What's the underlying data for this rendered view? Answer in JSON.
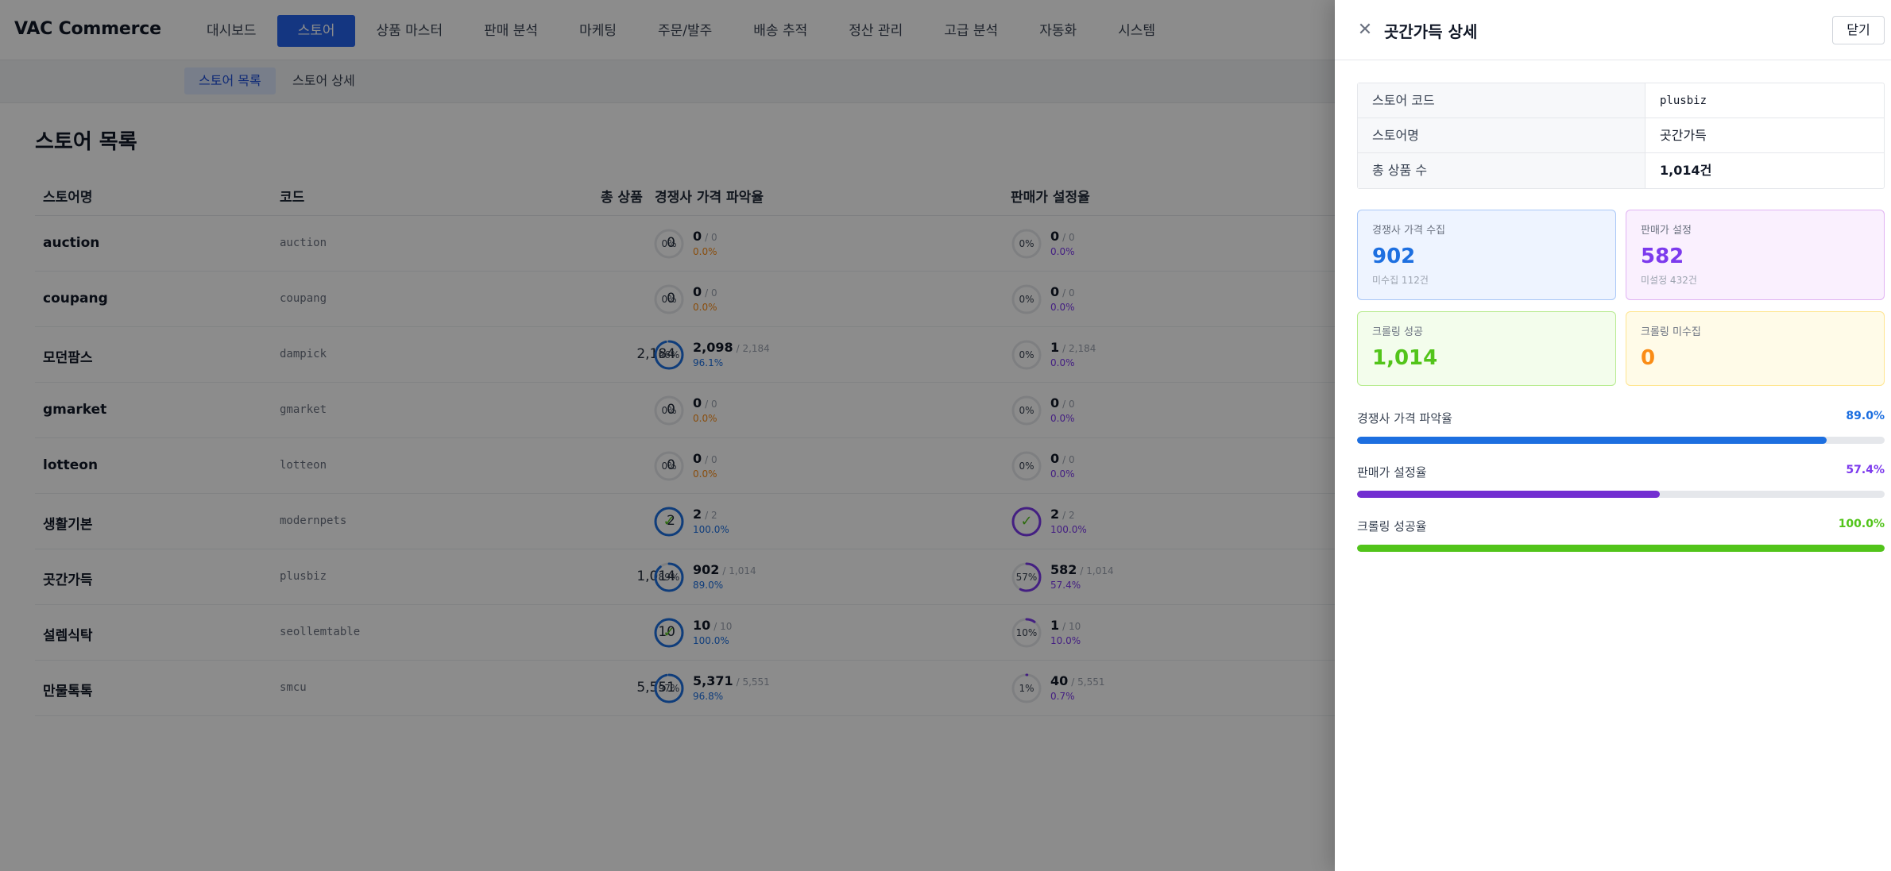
{
  "app": {
    "brand": "VAC Commerce",
    "menu": [
      {
        "label": "대시보드",
        "active": false
      },
      {
        "label": "스토어",
        "active": true
      },
      {
        "label": "상품 마스터",
        "active": false
      },
      {
        "label": "판매 분석",
        "active": false
      },
      {
        "label": "마케팅",
        "active": false
      },
      {
        "label": "주문/발주",
        "active": false
      },
      {
        "label": "배송 추적",
        "active": false
      },
      {
        "label": "정산 관리",
        "active": false
      },
      {
        "label": "고급 분석",
        "active": false
      },
      {
        "label": "자동화",
        "active": false
      },
      {
        "label": "시스템",
        "active": false
      }
    ],
    "subtabs": [
      {
        "label": "스토어 목록",
        "active": true
      },
      {
        "label": "스토어 상세",
        "active": false
      }
    ],
    "page_title": "스토어 목록"
  },
  "table": {
    "headers": {
      "name": "스토어명",
      "code": "코드",
      "total": "총 상품",
      "competitor": "경쟁사 가격 파악율",
      "price": "판매가 설정율"
    },
    "rows": [
      {
        "name": "auction",
        "code": "auction",
        "total": "0",
        "comp": {
          "ring": "0%",
          "fraction": 0,
          "done": false,
          "main": "0",
          "of": "/ 0",
          "pct": "0.0%"
        },
        "price": {
          "ring": "0%",
          "fraction": 0,
          "done": false,
          "main": "0",
          "of": "/ 0",
          "pct": "0.0%"
        }
      },
      {
        "name": "coupang",
        "code": "coupang",
        "total": "0",
        "comp": {
          "ring": "0%",
          "fraction": 0,
          "done": false,
          "main": "0",
          "of": "/ 0",
          "pct": "0.0%"
        },
        "price": {
          "ring": "0%",
          "fraction": 0,
          "done": false,
          "main": "0",
          "of": "/ 0",
          "pct": "0.0%"
        }
      },
      {
        "name": "모던팜스",
        "code": "dampick",
        "total": "2,184",
        "comp": {
          "ring": "96%",
          "fraction": 0.961,
          "done": false,
          "main": "2,098",
          "of": "/ 2,184",
          "pct": "96.1%"
        },
        "price": {
          "ring": "0%",
          "fraction": 0,
          "done": false,
          "main": "1",
          "of": "/ 2,184",
          "pct": "0.0%"
        }
      },
      {
        "name": "gmarket",
        "code": "gmarket",
        "total": "0",
        "comp": {
          "ring": "0%",
          "fraction": 0,
          "done": false,
          "main": "0",
          "of": "/ 0",
          "pct": "0.0%"
        },
        "price": {
          "ring": "0%",
          "fraction": 0,
          "done": false,
          "main": "0",
          "of": "/ 0",
          "pct": "0.0%"
        }
      },
      {
        "name": "lotteon",
        "code": "lotteon",
        "total": "0",
        "comp": {
          "ring": "0%",
          "fraction": 0,
          "done": false,
          "main": "0",
          "of": "/ 0",
          "pct": "0.0%"
        },
        "price": {
          "ring": "0%",
          "fraction": 0,
          "done": false,
          "main": "0",
          "of": "/ 0",
          "pct": "0.0%"
        }
      },
      {
        "name": "생활기본",
        "code": "modernpets",
        "total": "2",
        "comp": {
          "ring": "",
          "fraction": 1,
          "done": true,
          "main": "2",
          "of": "/ 2",
          "pct": "100.0%"
        },
        "price": {
          "ring": "",
          "fraction": 1,
          "done": true,
          "main": "2",
          "of": "/ 2",
          "pct": "100.0%"
        }
      },
      {
        "name": "곳간가득",
        "code": "plusbiz",
        "total": "1,014",
        "comp": {
          "ring": "89%",
          "fraction": 0.89,
          "done": false,
          "main": "902",
          "of": "/ 1,014",
          "pct": "89.0%"
        },
        "price": {
          "ring": "57%",
          "fraction": 0.574,
          "done": false,
          "main": "582",
          "of": "/ 1,014",
          "pct": "57.4%"
        }
      },
      {
        "name": "설렘식탁",
        "code": "seollemtable",
        "total": "10",
        "comp": {
          "ring": "",
          "fraction": 1,
          "done": true,
          "main": "10",
          "of": "/ 10",
          "pct": "100.0%"
        },
        "price": {
          "ring": "10%",
          "fraction": 0.1,
          "done": false,
          "main": "1",
          "of": "/ 10",
          "pct": "10.0%"
        }
      },
      {
        "name": "만물톡톡",
        "code": "smcu",
        "total": "5,551",
        "comp": {
          "ring": "97%",
          "fraction": 0.968,
          "done": false,
          "main": "5,371",
          "of": "/ 5,551",
          "pct": "96.8%"
        },
        "price": {
          "ring": "1%",
          "fraction": 0.007,
          "done": false,
          "main": "40",
          "of": "/ 5,551",
          "pct": "0.7%"
        }
      }
    ]
  },
  "drawer": {
    "title": "곳간가득 상세",
    "close_label": "닫기",
    "info": [
      {
        "key": "스토어 코드",
        "value": "plusbiz"
      },
      {
        "key": "스토어명",
        "value": "곳간가득"
      },
      {
        "key": "총 상품 수",
        "value": "1,014건"
      }
    ],
    "cards": [
      {
        "label": "경쟁사 가격 수집",
        "value": "902",
        "sub": "미수집 112건"
      },
      {
        "label": "판매가 설정",
        "value": "582",
        "sub": "미설정 432건"
      },
      {
        "label": "크롤링 성공",
        "value": "1,014"
      },
      {
        "label": "크롤링 미수집",
        "value": "0"
      }
    ],
    "bars": [
      {
        "label": "경쟁사 가격 파악율",
        "value": "89.0%",
        "fraction": 0.89
      },
      {
        "label": "판매가 설정율",
        "value": "57.4%",
        "fraction": 0.574
      },
      {
        "label": "크롤링 성공율",
        "value": "100.0%",
        "fraction": 1.0
      }
    ]
  },
  "colors": {
    "accent": "#2563eb",
    "competitor": "#1d6fe0",
    "price": "#7c3aed",
    "success": "#52c41a",
    "warning": "#fa8c16"
  }
}
